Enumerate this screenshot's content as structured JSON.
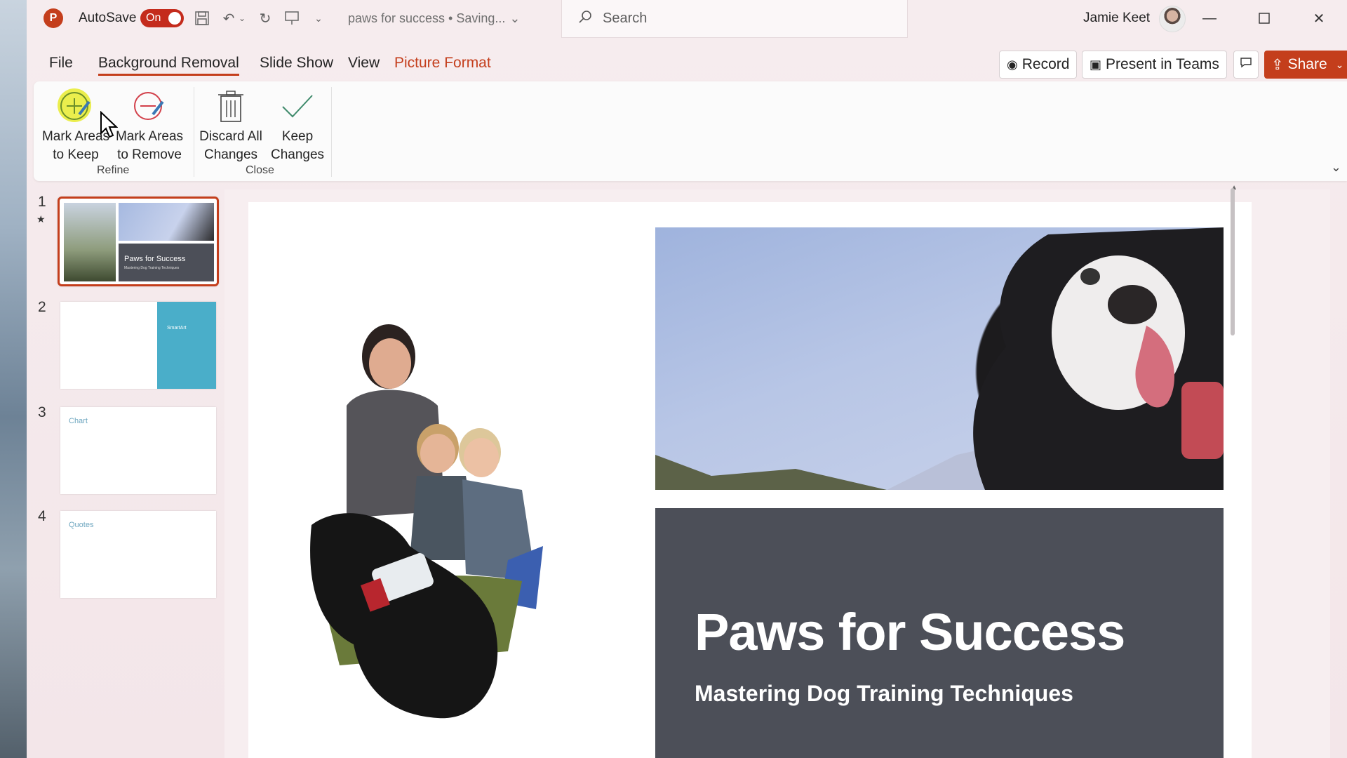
{
  "titlebar": {
    "app_logo": "P",
    "autosave_label": "AutoSave",
    "autosave_state": "On",
    "doc_title": "paws for success • Saving...",
    "search_placeholder": "Search",
    "user_name": "Jamie Keet"
  },
  "menu": {
    "file": "File",
    "background_removal": "Background Removal",
    "slide_show": "Slide Show",
    "view": "View",
    "picture_format": "Picture Format",
    "record": "Record",
    "present_in_teams": "Present in Teams",
    "share": "Share"
  },
  "ribbon": {
    "mark_keep_line1": "Mark Areas",
    "mark_keep_line2": "to Keep",
    "mark_remove_line1": "Mark Areas",
    "mark_remove_line2": "to Remove",
    "discard_line1": "Discard All",
    "discard_line2": "Changes",
    "keep_line1": "Keep",
    "keep_line2": "Changes",
    "group_refine": "Refine",
    "group_close": "Close"
  },
  "slides": [
    {
      "number": "1",
      "title": "Paws for Success",
      "subtitle": "Mastering Dog Training Techniques"
    },
    {
      "number": "2",
      "label": "SmartArt"
    },
    {
      "number": "3",
      "label": "Chart"
    },
    {
      "number": "4",
      "label": "Quotes"
    }
  ],
  "slide": {
    "title": "Paws for Success",
    "subtitle": "Mastering Dog Training Techniques"
  },
  "colors": {
    "accent": "#c43e1c",
    "panel": "#4c4f58",
    "thumb_teal": "#4aaec9"
  }
}
